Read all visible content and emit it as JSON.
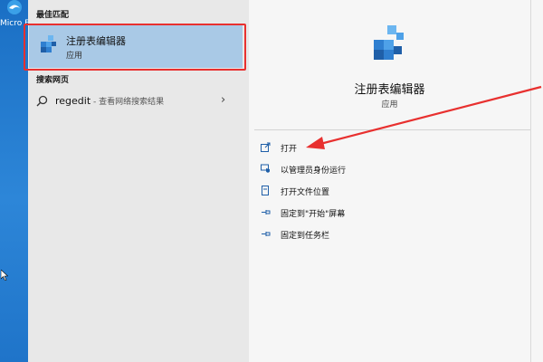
{
  "desktop": {
    "edge_label": "Micro Edg"
  },
  "left": {
    "best_match_heading": "最佳匹配",
    "best_match": {
      "name": "注册表编辑器",
      "type": "应用"
    },
    "web_heading": "搜索网页",
    "web_result": {
      "query": "regedit",
      "suffix": " - 查看网络搜索结果"
    }
  },
  "right": {
    "title": "注册表编辑器",
    "type": "应用",
    "actions": [
      {
        "label": "打开",
        "icon": "open-icon"
      },
      {
        "label": "以管理员身份运行",
        "icon": "shield-run-icon"
      },
      {
        "label": "打开文件位置",
        "icon": "file-location-icon"
      },
      {
        "label": "固定到\"开始\"屏幕",
        "icon": "pin-start-icon"
      },
      {
        "label": "固定到任务栏",
        "icon": "pin-taskbar-icon"
      }
    ]
  },
  "colors": {
    "highlight": "#a9c9e6",
    "annotation_red": "#e8302f",
    "desktop_blue": "#1e73c8"
  }
}
